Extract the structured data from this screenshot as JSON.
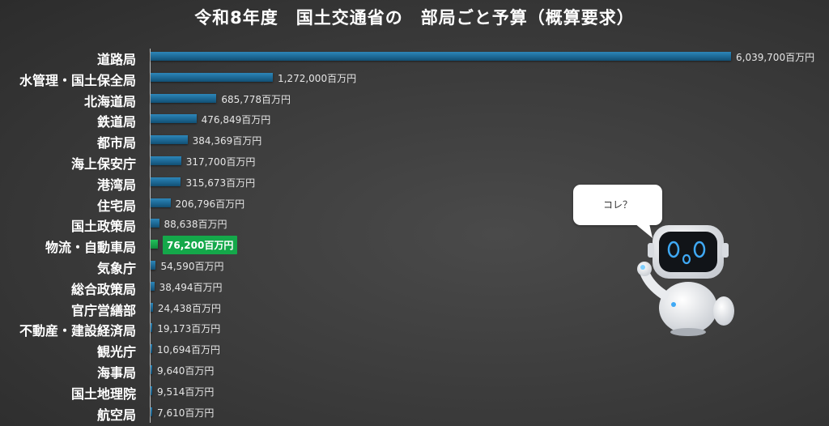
{
  "chart_data": {
    "type": "bar",
    "orientation": "horizontal",
    "title": "令和8年度　国土交通省の　部局ごと予算（概算要求）",
    "unit": "百万円",
    "categories": [
      "道路局",
      "水管理・国土保全局",
      "北海道局",
      "鉄道局",
      "都市局",
      "海上保安庁",
      "港湾局",
      "住宅局",
      "国土政策局",
      "物流・自動車局",
      "気象庁",
      "総合政策局",
      "官庁営繕部",
      "不動産・建設経済局",
      "観光庁",
      "海事局",
      "国土地理院",
      "航空局"
    ],
    "values": [
      6039700,
      1272000,
      685778,
      476849,
      384369,
      317700,
      315673,
      206796,
      88638,
      76200,
      54590,
      38494,
      24438,
      19173,
      10694,
      9640,
      9514,
      7610
    ],
    "value_labels": [
      "6,039,700百万円",
      "1,272,000百万円",
      "685,778百万円",
      "476,849百万円",
      "384,369百万円",
      "317,700百万円",
      "315,673百万円",
      "206,796百万円",
      "88,638百万円",
      "76,200百万円",
      "54,590百万円",
      "38,494百万円",
      "24,438百万円",
      "19,173百万円",
      "10,694百万円",
      "9,640百万円",
      "9,514百万円",
      "7,610百万円"
    ],
    "highlighted": "物流・自動車局",
    "xlim": [
      0,
      6200000
    ],
    "grid": false,
    "legend": "none"
  },
  "colors": {
    "bar": "#1f6e9c",
    "highlight": "#14a84a",
    "background": "#3a3a3a",
    "text": "#ffffff"
  },
  "callout": {
    "text": "コレ？"
  },
  "mascot": {
    "icon": "robot-mascot-icon"
  }
}
